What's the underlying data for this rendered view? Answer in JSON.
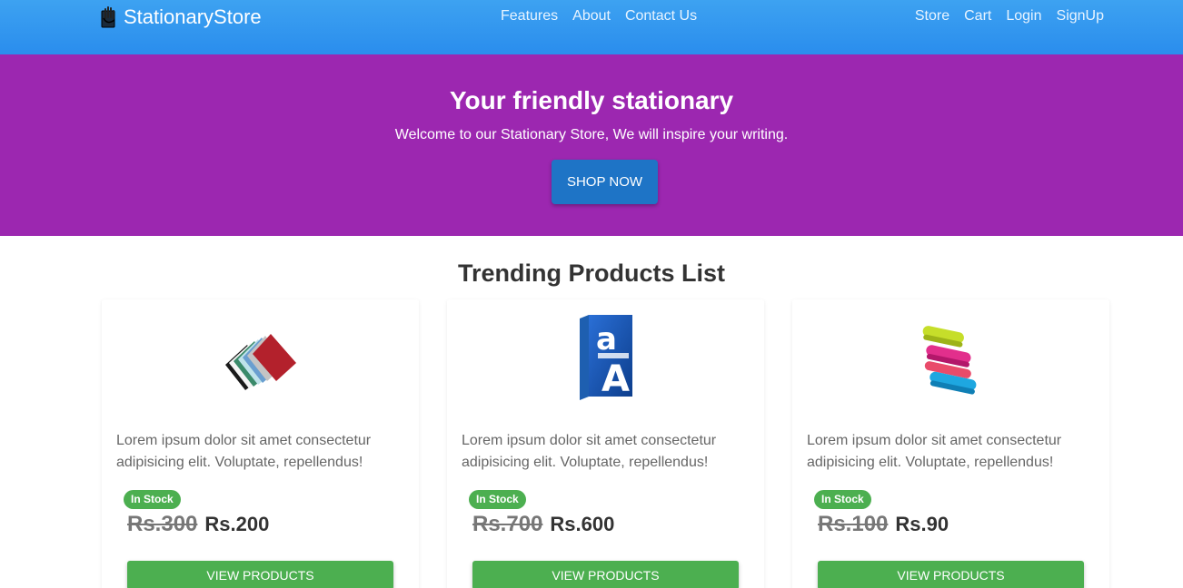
{
  "navbar": {
    "brand": "StationaryStore",
    "center_links": [
      "Features",
      "About",
      "Contact Us"
    ],
    "right_links": [
      "Store",
      "Cart",
      "Login",
      "SignUp"
    ]
  },
  "hero": {
    "title": "Your friendly stationary",
    "subtitle": "Welcome to our Stationary Store, We will inspire your writing.",
    "cta": "SHOP NOW",
    "background": "#9c27b0"
  },
  "section": {
    "title": "Trending Products List"
  },
  "products": [
    {
      "image": "folders-image",
      "description": "Lorem ipsum dolor sit amet consectetur adipisicing elit. Voluptate, repellendus!",
      "badge": "In Stock",
      "old_price": "Rs.300",
      "new_price": "Rs.200",
      "button": "VIEW PRODUCTS"
    },
    {
      "image": "paper-ream-image",
      "description": "Lorem ipsum dolor sit amet consectetur adipisicing elit. Voluptate, repellendus!",
      "badge": "In Stock",
      "old_price": "Rs.700",
      "new_price": "Rs.600",
      "button": "VIEW PRODUCTS"
    },
    {
      "image": "staplers-image",
      "description": "Lorem ipsum dolor sit amet consectetur adipisicing elit. Voluptate, repellendus!",
      "badge": "In Stock",
      "old_price": "Rs.100",
      "new_price": "Rs.90",
      "button": "VIEW PRODUCTS"
    }
  ],
  "colors": {
    "navbar": "#3da2f1",
    "hero": "#9c27b0",
    "cta": "#1e74c6",
    "success": "#4caf50"
  }
}
